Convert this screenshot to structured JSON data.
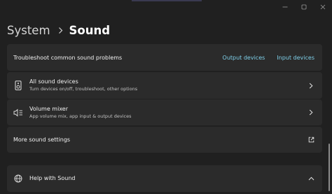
{
  "breadcrumb": {
    "parent": "System",
    "current": "Sound"
  },
  "troubleshoot": {
    "label": "Troubleshoot common sound problems",
    "output_link": "Output devices",
    "input_link": "Input devices"
  },
  "all_devices": {
    "title": "All sound devices",
    "subtitle": "Turn devices on/off, troubleshoot, other options",
    "icon": "speaker-icon"
  },
  "volume_mixer": {
    "title": "Volume mixer",
    "subtitle": "App volume mix, app input & output devices",
    "icon": "mixer-icon"
  },
  "more_settings": {
    "title": "More sound settings",
    "icon": "external-link-icon"
  },
  "help": {
    "title": "Help with Sound",
    "icon": "globe-icon"
  },
  "colors": {
    "background": "#202020",
    "card": "#2b2b2b",
    "accent_link": "#7fd0ea"
  }
}
